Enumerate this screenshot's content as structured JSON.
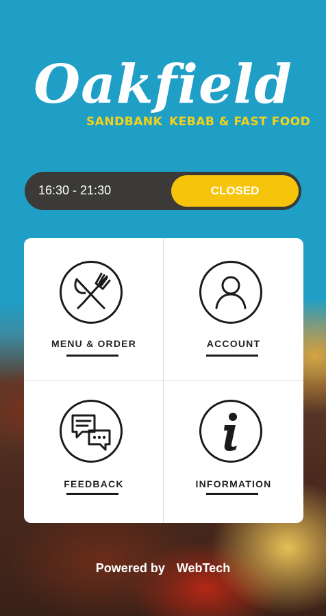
{
  "brand": {
    "name": "Oakfield",
    "sub_left": "SANDBANK",
    "sub_right": "KEBAB & FAST FOOD",
    "title_color": "#ffffff",
    "sub_color": "#f5d21a"
  },
  "hours": {
    "text": "16:30 - 21:30",
    "status": "CLOSED",
    "status_color": "#f6c40b"
  },
  "tiles": [
    {
      "label": "MENU & ORDER",
      "icon": "cutlery-icon"
    },
    {
      "label": "ACCOUNT",
      "icon": "user-icon"
    },
    {
      "label": "FEEDBACK",
      "icon": "chat-bubbles-icon"
    },
    {
      "label": "INFORMATION",
      "icon": "info-icon"
    }
  ],
  "footer": {
    "powered_by": "Powered by",
    "company": "WebTech"
  },
  "colors": {
    "sky_blue": "#1f9ec6",
    "bar_dark": "#3b3a38"
  }
}
